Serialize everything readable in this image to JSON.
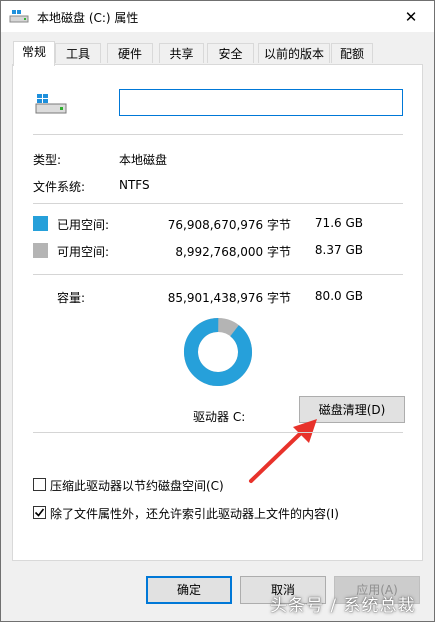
{
  "window": {
    "title": "本地磁盘 (C:) 属性",
    "close_symbol": "✕"
  },
  "tabs": [
    {
      "label": "常规"
    },
    {
      "label": "工具"
    },
    {
      "label": "硬件"
    },
    {
      "label": "共享"
    },
    {
      "label": "安全"
    },
    {
      "label": "以前的版本"
    },
    {
      "label": "配额"
    }
  ],
  "general": {
    "name_value": "",
    "type_label": "类型:",
    "type_value": "本地磁盘",
    "fs_label": "文件系统:",
    "fs_value": "NTFS",
    "used": {
      "label": "已用空间:",
      "bytes": "76,908,670,976 字节",
      "size": "71.6 GB",
      "color": "#26a0da"
    },
    "free": {
      "label": "可用空间:",
      "bytes": "8,992,768,000 字节",
      "size": "8.37 GB",
      "color": "#b4b4b4"
    },
    "capacity": {
      "label": "容量:",
      "bytes": "85,901,438,976 字节",
      "size": "80.0 GB"
    },
    "used_fraction": 0.895,
    "drive_label": "驱动器 C:",
    "cleanup_button": "磁盘清理(D)",
    "compress_label": "压缩此驱动器以节约磁盘空间(C)",
    "compress_checked": false,
    "index_label": "除了文件属性外，还允许索引此驱动器上文件的内容(I)",
    "index_checked": true,
    "annotation_arrow_color": "#e8322b"
  },
  "footer": {
    "ok": "确定",
    "cancel": "取消",
    "apply": "应用(A)"
  },
  "watermark": "头条号 / 系统总裁"
}
